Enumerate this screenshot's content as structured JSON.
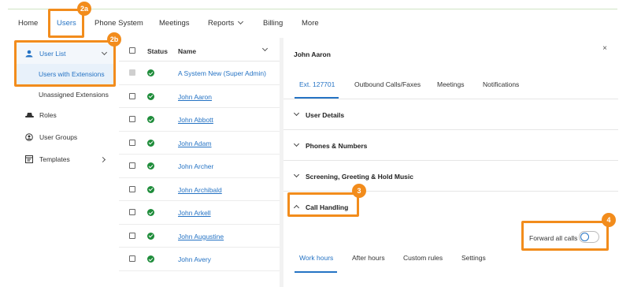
{
  "nav": {
    "items": [
      {
        "label": "Home"
      },
      {
        "label": "Users"
      },
      {
        "label": "Phone System"
      },
      {
        "label": "Meetings"
      },
      {
        "label": "Reports"
      },
      {
        "label": "Billing"
      },
      {
        "label": "More"
      }
    ],
    "active": "Users"
  },
  "sidebar": {
    "items": [
      {
        "label": "User List",
        "icon": "user-list-icon"
      },
      {
        "label": "Users with Extensions"
      },
      {
        "label": "Unassigned Extensions"
      },
      {
        "label": "Roles",
        "icon": "hat-icon"
      },
      {
        "label": "User Groups",
        "icon": "user-groups-icon"
      },
      {
        "label": "Templates",
        "icon": "template-icon"
      }
    ]
  },
  "table": {
    "headers": {
      "status": "Status",
      "name": "Name"
    },
    "rows": [
      {
        "name": "A System New (Super Admin)",
        "status": "active",
        "checkbox_disabled": true
      },
      {
        "name": "John Aaron",
        "status": "active"
      },
      {
        "name": "John Abbott",
        "status": "active"
      },
      {
        "name": "John Adam",
        "status": "active"
      },
      {
        "name": "John Archer",
        "status": "active"
      },
      {
        "name": "John Archibald",
        "status": "active"
      },
      {
        "name": "John Arkell",
        "status": "active"
      },
      {
        "name": "John Augustine",
        "status": "active"
      },
      {
        "name": "John Avery",
        "status": "active"
      }
    ]
  },
  "panel": {
    "title": "John Aaron",
    "close": "×",
    "tabs": [
      {
        "label": "Ext. 127701"
      },
      {
        "label": "Outbound Calls/Faxes"
      },
      {
        "label": "Meetings"
      },
      {
        "label": "Notifications"
      }
    ],
    "sections": [
      {
        "label": "User Details",
        "expanded": false
      },
      {
        "label": "Phones & Numbers",
        "expanded": false
      },
      {
        "label": "Screening, Greeting & Hold Music",
        "expanded": false
      },
      {
        "label": "Call Handling",
        "expanded": true
      }
    ],
    "forward_all_calls": {
      "label": "Forward all calls",
      "enabled": false
    },
    "subtabs": [
      {
        "label": "Work hours"
      },
      {
        "label": "After hours"
      },
      {
        "label": "Custom rules"
      },
      {
        "label": "Settings"
      }
    ]
  },
  "callouts": {
    "c2a": "2a",
    "c2b": "2b",
    "c3": "3",
    "c4": "4"
  },
  "colors": {
    "accent": "#2573c4",
    "callout": "#f28c1c",
    "status_active": "#1e8c3a"
  }
}
